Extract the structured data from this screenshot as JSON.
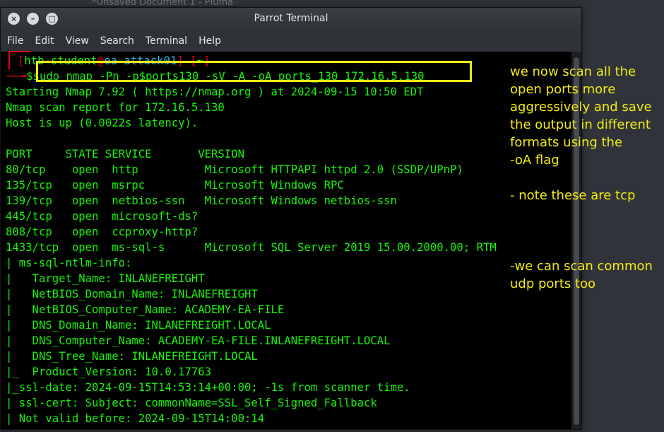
{
  "background_window": {
    "title": "*Unsaved Document 1 - Pluma"
  },
  "window": {
    "title": "Parrot Terminal",
    "controls": [
      "close-icon",
      "minimize-icon",
      "maximize-icon"
    ]
  },
  "menu": [
    "File",
    "Edit",
    "View",
    "Search",
    "Terminal",
    "Help"
  ],
  "prompt": {
    "open": "[",
    "user": "htb-student",
    "at": "@",
    "host": "ea-attack01",
    "sep": "]-[",
    "dir": "~",
    "close": "]",
    "arrow": "──╼",
    "command": "$sudo nmap -Pn -p$ports130 -sV -A -oA ports_130 172.16.5.130"
  },
  "output": [
    "Starting Nmap 7.92 ( https://nmap.org ) at 2024-09-15 10:50 EDT",
    "Nmap scan report for 172.16.5.130",
    "Host is up (0.0022s latency).",
    "",
    "PORT     STATE SERVICE       VERSION",
    "80/tcp    open  http          Microsoft HTTPAPI httpd 2.0 (SSDP/UPnP)",
    "135/tcp   open  msrpc         Microsoft Windows RPC",
    "139/tcp   open  netbios-ssn   Microsoft Windows netbios-ssn",
    "445/tcp   open  microsoft-ds?",
    "808/tcp   open  ccproxy-http?",
    "1433/tcp  open  ms-sql-s      Microsoft SQL Server 2019 15.00.2000.00; RTM",
    "| ms-sql-ntlm-info:",
    "|   Target_Name: INLANEFREIGHT",
    "|   NetBIOS_Domain_Name: INLANEFREIGHT",
    "|   NetBIOS_Computer_Name: ACADEMY-EA-FILE",
    "|   DNS_Domain_Name: INLANEFREIGHT.LOCAL",
    "|   DNS_Computer_Name: ACADEMY-EA-FILE.INLANEFREIGHT.LOCAL",
    "|   DNS_Tree_Name: INLANEFREIGHT.LOCAL",
    "|_  Product_Version: 10.0.17763",
    "|_ssl-date: 2024-09-15T14:53:14+00:00; -1s from scanner time.",
    "| ssl-cert: Subject: commonName=SSL_Self_Signed_Fallback",
    "| Not valid before: 2024-09-15T14:00:14"
  ],
  "annotations": {
    "note1": "we now scan all the\nopen ports more\naggressively and save\nthe output in different\nformats using the\n-oA flag",
    "note2": "- note these are tcp",
    "note3": "-we can scan common\nudp ports too"
  },
  "colors": {
    "terminal_text": "#19f20a",
    "prompt_red": "#e6001a",
    "prompt_host": "#29b6e6",
    "highlight": "#f3eb11"
  }
}
